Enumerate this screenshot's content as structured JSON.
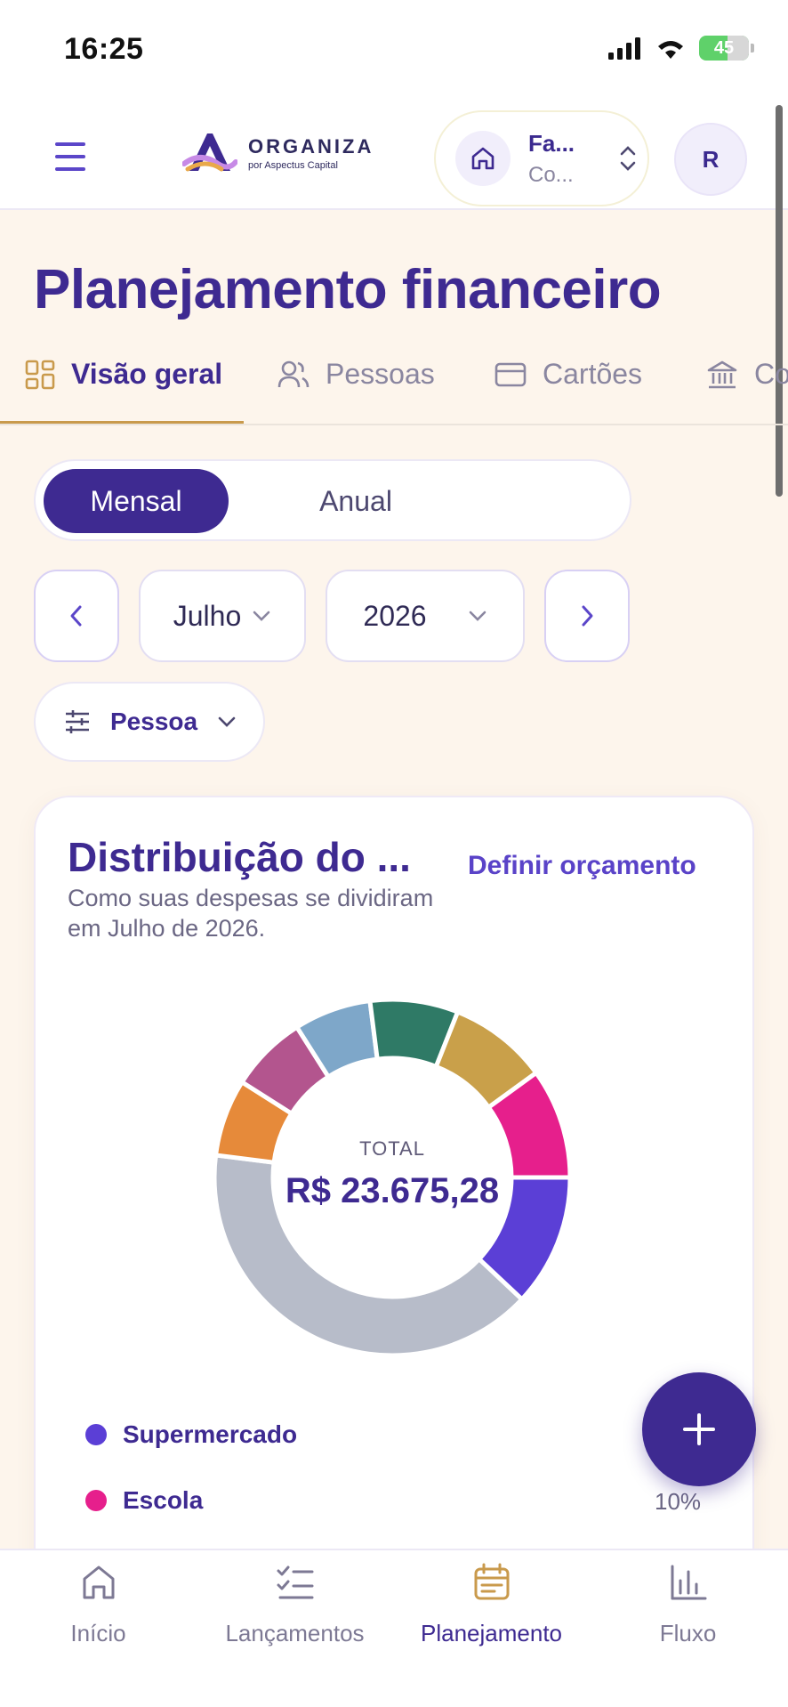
{
  "status_bar": {
    "time": "16:25",
    "battery": "45"
  },
  "header": {
    "logo_name": "ORGANIZA",
    "logo_tagline": "por Aspectus Capital",
    "family_name": "Fa...",
    "family_sub": "Co...",
    "avatar_initial": "R"
  },
  "page": {
    "title": "Planejamento financeiro"
  },
  "tabs": [
    {
      "label": "Visão geral",
      "icon": "grid-icon",
      "active": true
    },
    {
      "label": "Pessoas",
      "icon": "users-icon",
      "active": false
    },
    {
      "label": "Cartões",
      "icon": "credit-card-icon",
      "active": false
    },
    {
      "label": "Co",
      "icon": "bank-icon",
      "active": false
    }
  ],
  "segmented": {
    "monthly": "Mensal",
    "annual": "Anual",
    "selected": "Mensal"
  },
  "period": {
    "month": "Julho",
    "year": "2026"
  },
  "filter": {
    "label": "Pessoa"
  },
  "card": {
    "title": "Distribuição do ...",
    "link": "Definir orçamento",
    "subtitle": "Como suas despesas se dividiram em Julho de 2026.",
    "total_label": "TOTAL",
    "total_value": "R$ 23.675,28"
  },
  "chart_data": {
    "type": "pie",
    "total": "R$ 23.675,28",
    "slices": [
      {
        "name": "Supermercado",
        "value": 12,
        "color": "#5b3fd6"
      },
      {
        "name": "",
        "value": 40,
        "color": "#b7bcc9"
      },
      {
        "name": "",
        "value": 7,
        "color": "#e68a3a"
      },
      {
        "name": "",
        "value": 7,
        "color": "#b3558e"
      },
      {
        "name": "",
        "value": 7,
        "color": "#7ea7c9"
      },
      {
        "name": "",
        "value": 8,
        "color": "#2f7a66"
      },
      {
        "name": "",
        "value": 9,
        "color": "#c9a04a"
      },
      {
        "name": "Escola",
        "value": 10,
        "color": "#e61f8c"
      }
    ]
  },
  "legend": [
    {
      "name": "Supermercado",
      "color": "#5b3fd6",
      "pct": ""
    },
    {
      "name": "Escola",
      "color": "#e61f8c",
      "pct": "10%"
    }
  ],
  "bottom_nav": [
    {
      "label": "Início",
      "icon": "home-icon",
      "active": false
    },
    {
      "label": "Lançamentos",
      "icon": "checklist-icon",
      "active": false
    },
    {
      "label": "Planejamento",
      "icon": "calendar-icon",
      "active": true
    },
    {
      "label": "Fluxo",
      "icon": "bar-chart-icon",
      "active": false
    }
  ],
  "colors": {
    "primary": "#3e2a91",
    "accent": "#c99a4c",
    "background": "#fdf5ec"
  }
}
